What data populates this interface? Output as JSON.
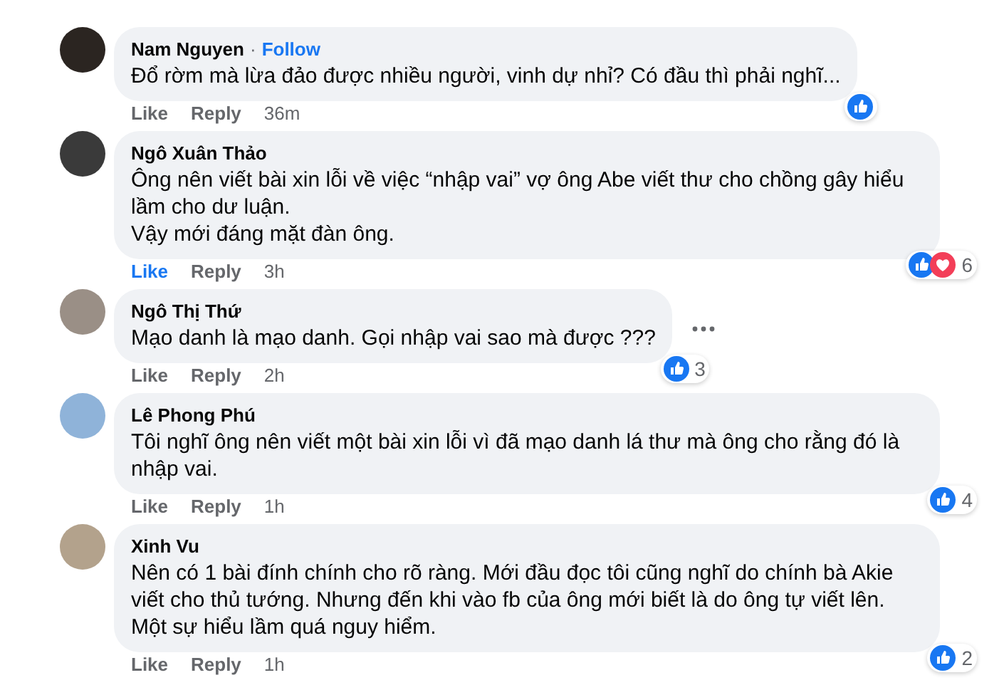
{
  "comments": [
    {
      "author": "Nam Nguyen",
      "separator": "·",
      "follow": "Follow",
      "text": "Đổ rờm mà lừa đảo được nhiều người, vinh dự nhỉ? Có đầu thì phải nghĩ...",
      "like": "Like",
      "liked": false,
      "reply": "Reply",
      "time": "36m",
      "reactions": [
        {
          "kind": "like"
        }
      ],
      "more": false
    },
    {
      "author": "Ngô Xuân Thảo",
      "text": "Ông nên viết bài xin lỗi về việc “nhập vai” vợ ông Abe viết thư cho chồng gây hiểu lầm cho dư luận.\nVậy mới đáng mặt đàn ông.",
      "like": "Like",
      "liked": true,
      "reply": "Reply",
      "time": "3h",
      "reactions": [
        {
          "kind": "like"
        },
        {
          "kind": "love"
        }
      ],
      "count": "6",
      "more": false
    },
    {
      "author": "Ngô Thị Thứ",
      "text": "Mạo danh là mạo danh. Gọi nhập vai sao mà được ???",
      "like": "Like",
      "liked": false,
      "reply": "Reply",
      "time": "2h",
      "reactions": [
        {
          "kind": "like"
        }
      ],
      "count": "3",
      "more": true
    },
    {
      "author": "Lê Phong Phú",
      "text": "Tôi nghĩ ông nên viết một bài xin lỗi vì đã mạo danh lá thư mà ông cho rằng đó là nhập vai.",
      "like": "Like",
      "liked": false,
      "reply": "Reply",
      "time": "1h",
      "reactions": [
        {
          "kind": "like"
        }
      ],
      "count": "4",
      "more": false
    },
    {
      "author": "Xinh Vu",
      "text": "Nên có 1 bài đính chính cho rõ ràng. Mới đầu đọc tôi cũng nghĩ do chính bà Akie viết cho thủ tướng. Nhưng đến khi vào fb của ông mới biết là do ông tự viết lên. Một sự hiểu lầm quá nguy hiểm.",
      "like": "Like",
      "liked": false,
      "reply": "Reply",
      "time": "1h",
      "reactions": [
        {
          "kind": "like"
        }
      ],
      "count": "2",
      "more": false
    }
  ]
}
